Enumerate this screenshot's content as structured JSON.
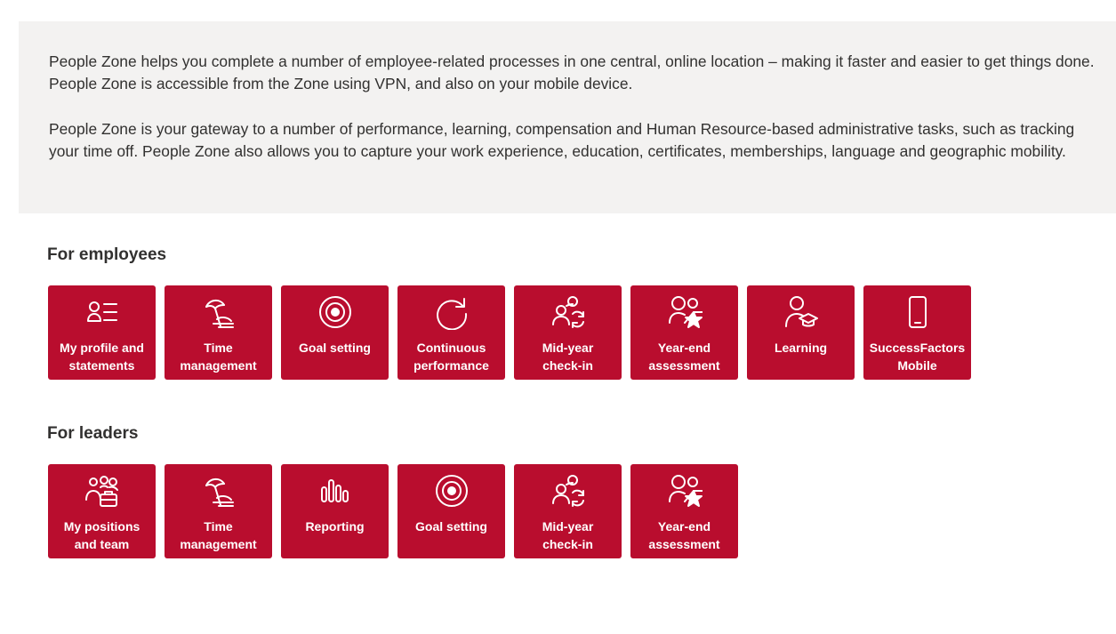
{
  "intro": {
    "paragraph1": "People Zone helps you complete a number of employee-related processes in one central, online location – making it faster and easier to get things done. People Zone is accessible from the Zone using VPN, and also on your mobile device.",
    "paragraph2": "People Zone is your gateway to a number of performance, learning, compensation and Human Resource-based administrative tasks, such as tracking your time off. People Zone also allows you to capture your work experience, education, certificates, memberships, language and geographic mobility."
  },
  "employees": {
    "title": "For employees",
    "tiles": [
      {
        "icon": "profile-list-icon",
        "line1": "My profile and",
        "line2": "statements"
      },
      {
        "icon": "beach-umbrella-icon",
        "line1": "Time",
        "line2": "management"
      },
      {
        "icon": "target-icon",
        "line1": "Goal setting",
        "line2": ""
      },
      {
        "icon": "refresh-icon",
        "line1": "Continuous",
        "line2": "performance"
      },
      {
        "icon": "people-sync-icon",
        "line1": "Mid-year",
        "line2": "check-in"
      },
      {
        "icon": "person-star-icon",
        "line1": "Year-end",
        "line2": "assessment"
      },
      {
        "icon": "person-graduation-icon",
        "line1": "Learning",
        "line2": ""
      },
      {
        "icon": "mobile-phone-icon",
        "line1": "SuccessFactors",
        "line2": "Mobile"
      }
    ]
  },
  "leaders": {
    "title": "For leaders",
    "tiles": [
      {
        "icon": "team-briefcase-icon",
        "line1": "My positions",
        "line2": "and team"
      },
      {
        "icon": "beach-umbrella-icon",
        "line1": "Time",
        "line2": "management"
      },
      {
        "icon": "bar-chart-icon",
        "line1": "Reporting",
        "line2": ""
      },
      {
        "icon": "target-icon",
        "line1": "Goal setting",
        "line2": ""
      },
      {
        "icon": "people-sync-icon",
        "line1": "Mid-year",
        "line2": "check-in"
      },
      {
        "icon": "person-star-icon",
        "line1": "Year-end",
        "line2": "assessment"
      }
    ]
  },
  "colors": {
    "tile_background": "#b90d2e",
    "intro_background": "#f3f2f1",
    "text": "#323130"
  }
}
